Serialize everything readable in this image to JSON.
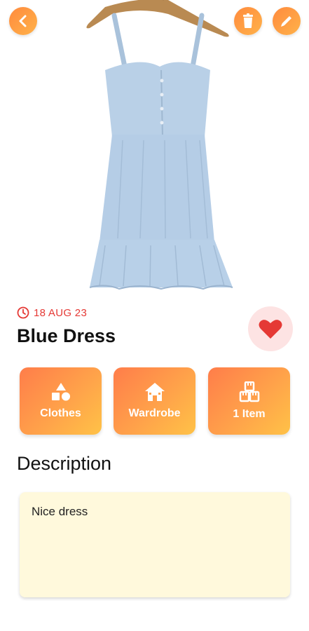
{
  "item": {
    "date": "18 AUG 23",
    "title": "Blue Dress",
    "favorite": true,
    "image": "blue-sundress-on-hanger"
  },
  "actions": {
    "back_icon": "chevron-left-icon",
    "delete_icon": "trash-icon",
    "edit_icon": "pencil-icon"
  },
  "tiles": [
    {
      "label": "Clothes",
      "icon": "shapes-icon"
    },
    {
      "label": "Wardrobe",
      "icon": "house-icon"
    },
    {
      "label": "1 Item",
      "icon": "boxes-icon"
    }
  ],
  "description": {
    "heading": "Description",
    "text": "Nice dress"
  },
  "colors": {
    "accent_orange": "#ff8a3d",
    "accent_yellow": "#ffc247",
    "date_red": "#e53935",
    "heart_red": "#e53935",
    "fav_bg": "#fde3e3",
    "desc_bg": "#fff9dc",
    "dress_blue": "#b6cfe6"
  }
}
